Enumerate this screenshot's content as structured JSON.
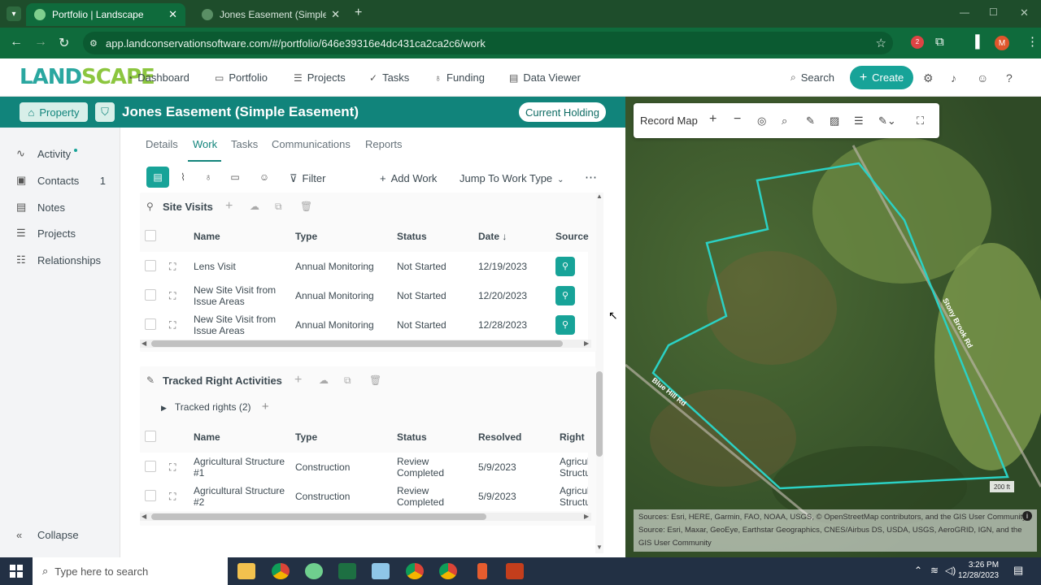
{
  "browser": {
    "tabs": [
      {
        "title": "Portfolio | Landscape"
      },
      {
        "title": "Jones Easement (Simple Easeme"
      }
    ],
    "url": "app.landconservationsoftware.com/#/portfolio/646e39316e4dc431ca2ca2c6/work",
    "profile_initial": "M",
    "extensions_badge": "2"
  },
  "app": {
    "logo_text_a": "LAND",
    "logo_text_b": "SCAPE",
    "nav": [
      "Dashboard",
      "Portfolio",
      "Projects",
      "Tasks",
      "Funding",
      "Data Viewer"
    ],
    "search_label": "Search",
    "create_label": "Create"
  },
  "property": {
    "type_label": "Property",
    "title": "Jones Easement (Simple Easement)",
    "status": "Current Holding"
  },
  "sidebar": {
    "items": [
      {
        "label": "Activity",
        "count": ""
      },
      {
        "label": "Contacts",
        "count": "1"
      },
      {
        "label": "Notes",
        "count": ""
      },
      {
        "label": "Projects",
        "count": ""
      },
      {
        "label": "Relationships",
        "count": ""
      }
    ],
    "collapse_label": "Collapse"
  },
  "subtabs": [
    "Details",
    "Work",
    "Tasks",
    "Communications",
    "Reports"
  ],
  "toolbar": {
    "filter_label": "Filter",
    "add_work_label": "Add Work",
    "jump_label": "Jump To Work Type"
  },
  "site_visits": {
    "title": "Site Visits",
    "columns": [
      "Name",
      "Type",
      "Status",
      "Date ↓",
      "Source"
    ],
    "rows": [
      {
        "name": "Lens Visit",
        "type": "Annual Monitoring",
        "status": "Not Started",
        "date": "12/19/2023"
      },
      {
        "name": "New Site Visit from Issue Areas",
        "type": "Annual Monitoring",
        "status": "Not Started",
        "date": "12/20/2023"
      },
      {
        "name": "New Site Visit from Issue Areas",
        "type": "Annual Monitoring",
        "status": "Not Started",
        "date": "12/28/2023"
      }
    ]
  },
  "tracked_rights": {
    "title": "Tracked Right Activities",
    "group_label": "Tracked rights (2)",
    "columns": [
      "Name",
      "Type",
      "Status",
      "Resolved",
      "Right"
    ],
    "rows": [
      {
        "name": "Agricultural Structure #1",
        "type": "Construction",
        "status": "Review Completed",
        "resolved": "5/9/2023",
        "right": "Agricul Structu"
      },
      {
        "name": "Agricultural Structure #2",
        "type": "Construction",
        "status": "Review Completed",
        "resolved": "5/9/2023",
        "right": "Agricul Structu"
      }
    ]
  },
  "map": {
    "title": "Record Map",
    "road_1": "Stony Brook Rd",
    "road_2": "Blue Hill Rd",
    "scale": "200 ft",
    "attribution": "Sources: Esri, HERE, Garmin, FAO, NOAA, USGS, © OpenStreetMap contributors, and the GIS User Community | Source: Esri, Maxar, GeoEye, Earthstar Geographics, CNES/Airbus DS, USDA, USGS, AeroGRID, IGN, and the GIS User Community"
  },
  "taskbar": {
    "search_placeholder": "Type here to search",
    "time": "3:26 PM",
    "date": "12/28/2023"
  }
}
